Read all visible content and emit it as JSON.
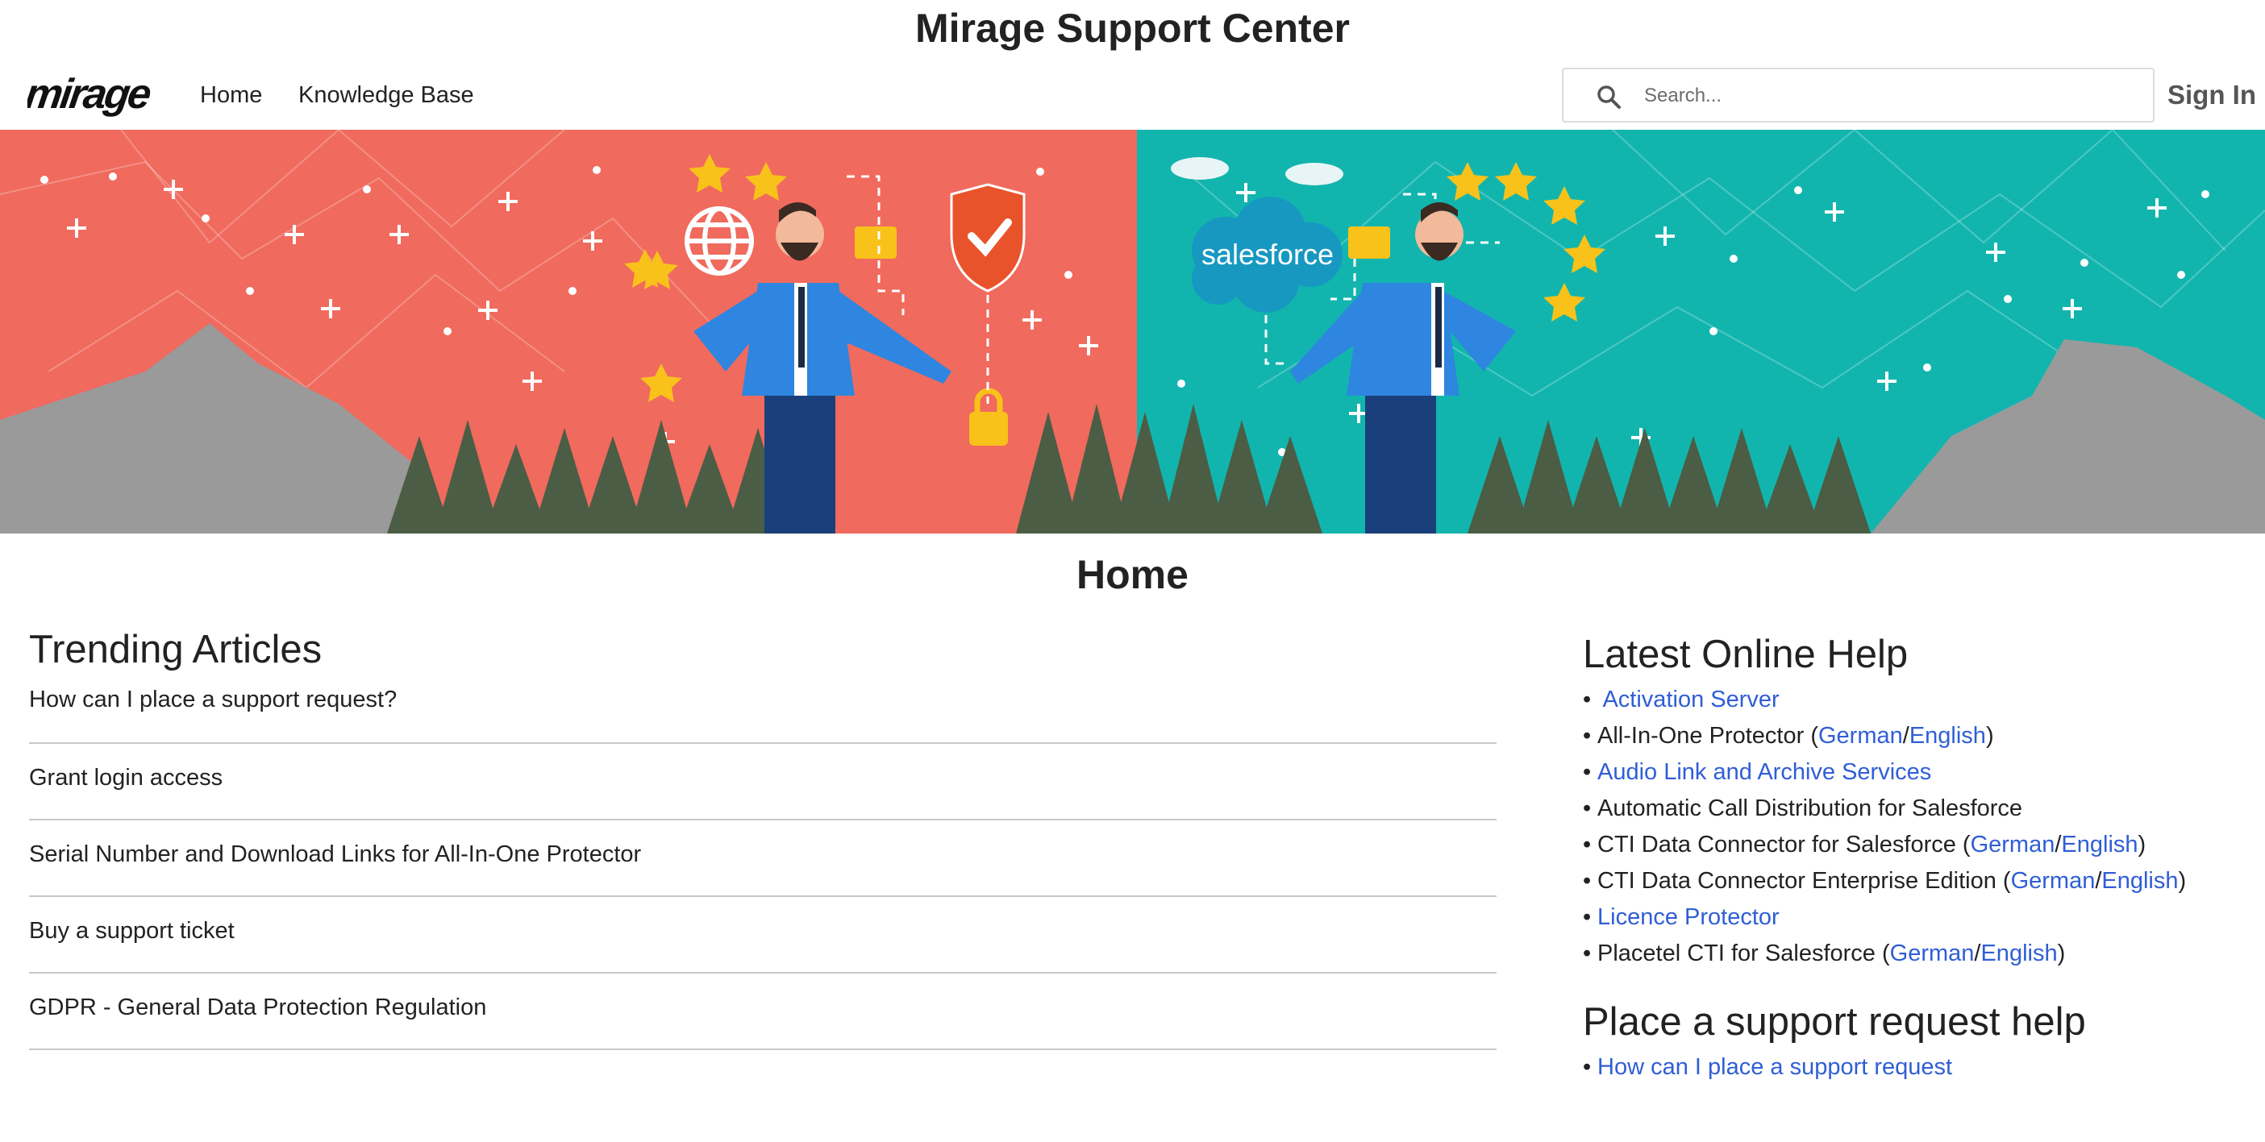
{
  "site": {
    "title": "Mirage Support Center"
  },
  "nav": {
    "logo_text": "mirage",
    "links": {
      "home": "Home",
      "knowledge_base": "Knowledge Base"
    },
    "search_placeholder": "Search...",
    "sign_in": "Sign In"
  },
  "banner": {
    "cloud_label": "salesforce"
  },
  "page": {
    "heading": "Home"
  },
  "trending": {
    "title": "Trending Articles",
    "articles": [
      "How can I place a support request?",
      "Grant login access",
      "Serial Number and Download Links for All-In-One Protector",
      "Buy a support ticket",
      "GDPR - General Data Protection Regulation"
    ]
  },
  "online_help": {
    "title": "Latest Online Help",
    "bullet": "•",
    "items": {
      "activation_server": "Activation Server",
      "all_in_one": {
        "text": "All-In-One Protector (",
        "german": "German",
        "sep": "/",
        "english": "English",
        "close": ")"
      },
      "audio_link": "Audio Link and Archive Services",
      "acd": "Automatic Call Distribution for Salesforce",
      "cti_sf": {
        "text": "CTI Data Connector for Salesforce (",
        "german": "German",
        "sep": "/",
        "english": "English",
        "close": ")"
      },
      "cti_ee": {
        "text": "CTI Data Connector Enterprise Edition (",
        "german": "German",
        "sep": "/",
        "english": "English",
        "close": ")"
      },
      "licence": "Licence Protector",
      "placetel": {
        "text": "Placetel CTI for Salesforce (",
        "german": "German",
        "sep": "/",
        "english": "English",
        "close": ")"
      }
    }
  },
  "support_help": {
    "title": "Place a support request help",
    "link": "How can I place a support request"
  },
  "colors": {
    "banner_left": "#f06a5e",
    "banner_right": "#12b5ad",
    "link": "#2f5ed6",
    "trees": "#4b5d45"
  }
}
